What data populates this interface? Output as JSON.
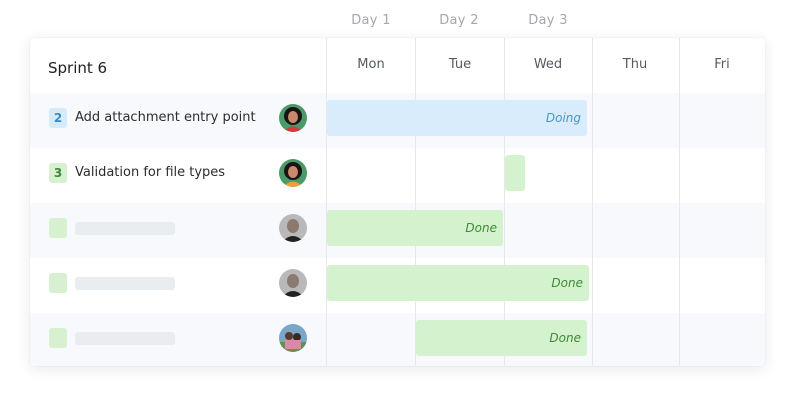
{
  "days_header": [
    "Day 1",
    "Day 2",
    "Day 3"
  ],
  "sprint": {
    "title": "Sprint 6"
  },
  "weekdays": [
    "Mon",
    "Tue",
    "Wed",
    "Thu",
    "Fri"
  ],
  "tasks": [
    {
      "badge": "2",
      "title": "Add attachment entry point",
      "status": "Doing",
      "badge_color": "blue",
      "avatar": "person-dark-hair-avatar"
    },
    {
      "badge": "3",
      "title": "Validation for file types",
      "status": "",
      "badge_color": "green",
      "avatar": "person-dark-hair-avatar"
    },
    {
      "badge": "",
      "title": "",
      "status": "Done",
      "badge_color": "green",
      "avatar": "person-bald-avatar"
    },
    {
      "badge": "",
      "title": "",
      "status": "Done",
      "badge_color": "green",
      "avatar": "person-bald-avatar"
    },
    {
      "badge": "",
      "title": "",
      "status": "Done",
      "badge_color": "green",
      "avatar": "person-outdoor-avatar"
    }
  ],
  "colors": {
    "doing": "#d9ecfb",
    "done": "#d5f2cf",
    "row_shade": "#f7f9fc"
  }
}
